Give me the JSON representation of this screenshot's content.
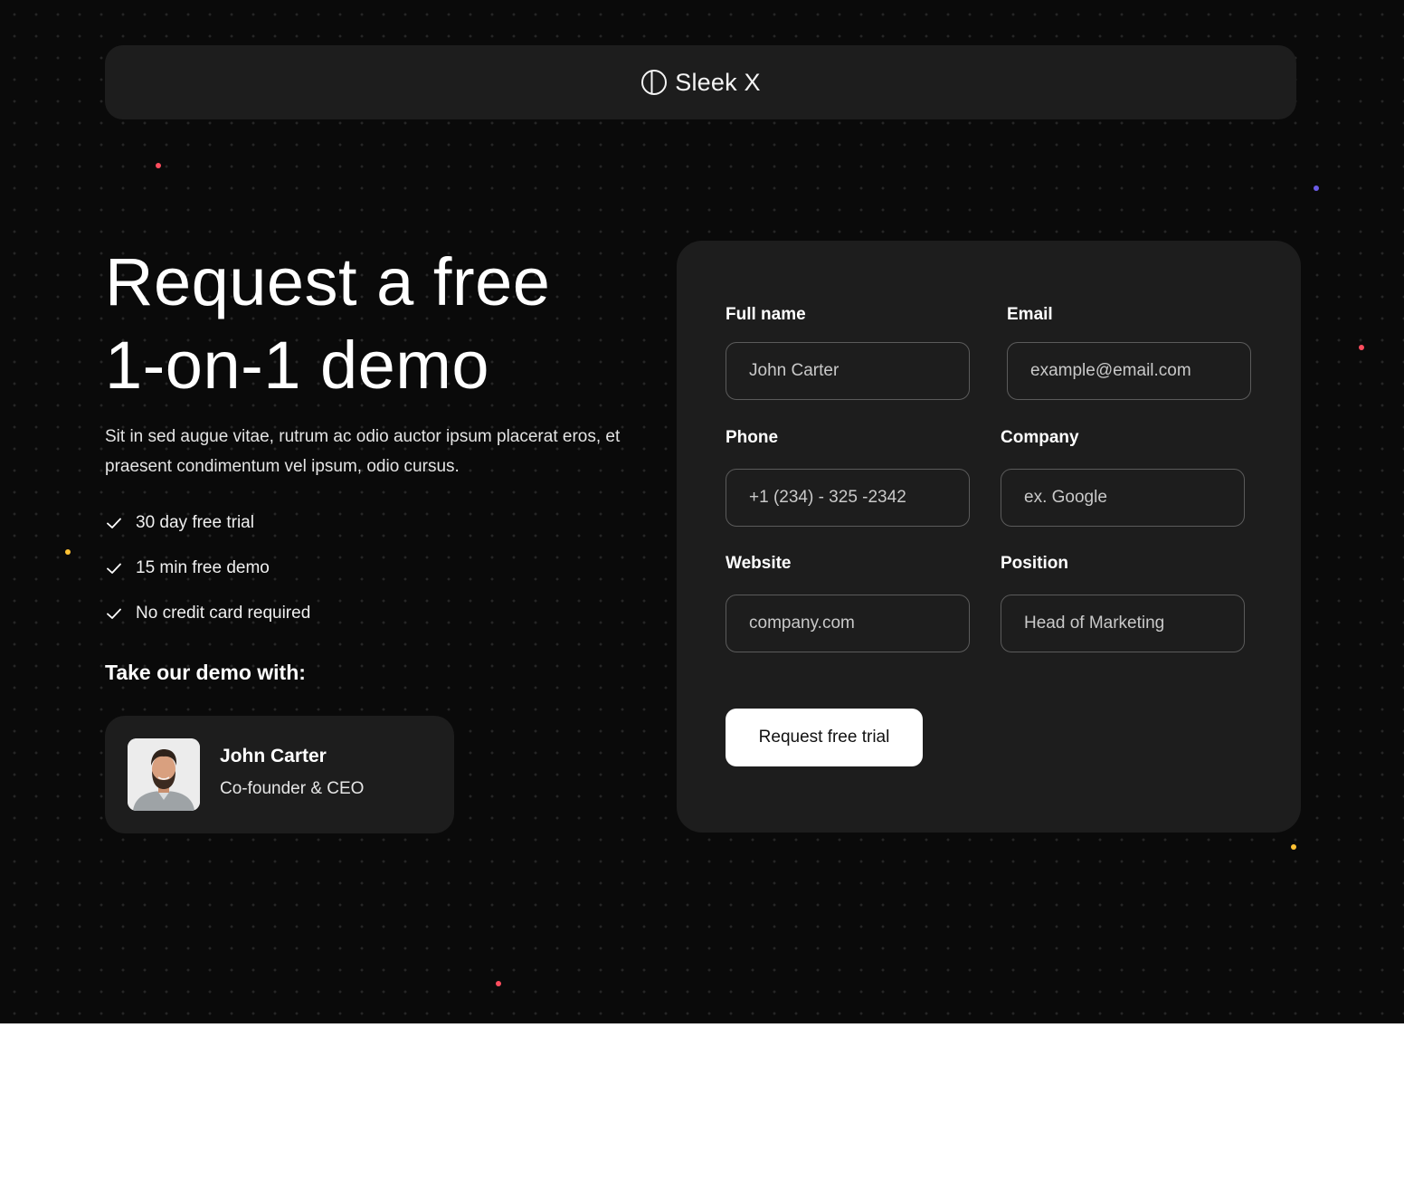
{
  "brand": {
    "name": "Sleek X",
    "icon": "half-circle-logo-icon"
  },
  "hero": {
    "headline_line1": "Request a free",
    "headline_line2": "1-on-1 demo",
    "subtitle": "Sit in sed augue vitae, rutrum ac odio auctor ipsum placerat eros, et praesent condimentum vel ipsum, odio cursus.",
    "features": [
      {
        "icon": "check-icon",
        "label": "30 day free trial"
      },
      {
        "icon": "check-icon",
        "label": "15 min free demo"
      },
      {
        "icon": "check-icon",
        "label": "No credit card required"
      }
    ],
    "demo_heading": "Take our demo with:",
    "presenter": {
      "name": "John Carter",
      "role": "Co-founder & CEO"
    }
  },
  "form": {
    "fields": {
      "full_name": {
        "label": "Full name",
        "placeholder": "John Carter"
      },
      "email": {
        "label": "Email",
        "placeholder": "example@email.com"
      },
      "phone": {
        "label": "Phone",
        "placeholder": "+1 (234) - 325 -2342"
      },
      "company": {
        "label": "Company",
        "placeholder": "ex. Google"
      },
      "website": {
        "label": "Website",
        "placeholder": "company.com"
      },
      "position": {
        "label": "Position",
        "placeholder": "Head of Marketing"
      }
    },
    "submit_label": "Request free trial"
  },
  "colors": {
    "page_background": "#0a0a0a",
    "card_background": "#1d1d1d",
    "input_border": "#5b5b5b",
    "accent_red": "#ff4d5e",
    "accent_purple": "#6c5ce7",
    "accent_yellow": "#ffc234"
  }
}
